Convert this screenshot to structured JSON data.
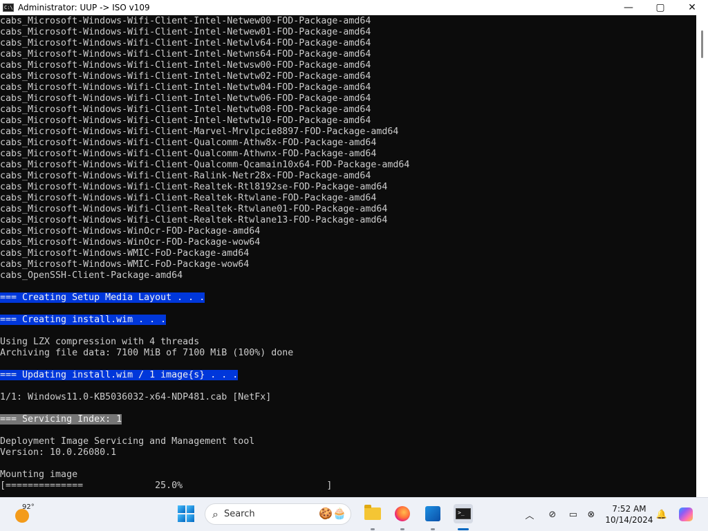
{
  "window": {
    "title": "Administrator:  UUP -> ISO v109",
    "controls": {
      "minimize": "—",
      "maximize": "▢",
      "close": "✕"
    }
  },
  "console": {
    "lines": [
      {
        "text": "cabs_Microsoft-Windows-Wifi-Client-Intel-Netwew00-FOD-Package-amd64",
        "style": ""
      },
      {
        "text": "cabs_Microsoft-Windows-Wifi-Client-Intel-Netwew01-FOD-Package-amd64",
        "style": ""
      },
      {
        "text": "cabs_Microsoft-Windows-Wifi-Client-Intel-Netwlv64-FOD-Package-amd64",
        "style": ""
      },
      {
        "text": "cabs_Microsoft-Windows-Wifi-Client-Intel-Netwns64-FOD-Package-amd64",
        "style": ""
      },
      {
        "text": "cabs_Microsoft-Windows-Wifi-Client-Intel-Netwsw00-FOD-Package-amd64",
        "style": ""
      },
      {
        "text": "cabs_Microsoft-Windows-Wifi-Client-Intel-Netwtw02-FOD-Package-amd64",
        "style": ""
      },
      {
        "text": "cabs_Microsoft-Windows-Wifi-Client-Intel-Netwtw04-FOD-Package-amd64",
        "style": ""
      },
      {
        "text": "cabs_Microsoft-Windows-Wifi-Client-Intel-Netwtw06-FOD-Package-amd64",
        "style": ""
      },
      {
        "text": "cabs_Microsoft-Windows-Wifi-Client-Intel-Netwtw08-FOD-Package-amd64",
        "style": ""
      },
      {
        "text": "cabs_Microsoft-Windows-Wifi-Client-Intel-Netwtw10-FOD-Package-amd64",
        "style": ""
      },
      {
        "text": "cabs_Microsoft-Windows-Wifi-Client-Marvel-Mrvlpcie8897-FOD-Package-amd64",
        "style": ""
      },
      {
        "text": "cabs_Microsoft-Windows-Wifi-Client-Qualcomm-Athw8x-FOD-Package-amd64",
        "style": ""
      },
      {
        "text": "cabs_Microsoft-Windows-Wifi-Client-Qualcomm-Athwnx-FOD-Package-amd64",
        "style": ""
      },
      {
        "text": "cabs_Microsoft-Windows-Wifi-Client-Qualcomm-Qcamain10x64-FOD-Package-amd64",
        "style": ""
      },
      {
        "text": "cabs_Microsoft-Windows-Wifi-Client-Ralink-Netr28x-FOD-Package-amd64",
        "style": ""
      },
      {
        "text": "cabs_Microsoft-Windows-Wifi-Client-Realtek-Rtl8192se-FOD-Package-amd64",
        "style": ""
      },
      {
        "text": "cabs_Microsoft-Windows-Wifi-Client-Realtek-Rtwlane-FOD-Package-amd64",
        "style": ""
      },
      {
        "text": "cabs_Microsoft-Windows-Wifi-Client-Realtek-Rtwlane01-FOD-Package-amd64",
        "style": ""
      },
      {
        "text": "cabs_Microsoft-Windows-Wifi-Client-Realtek-Rtwlane13-FOD-Package-amd64",
        "style": ""
      },
      {
        "text": "cabs_Microsoft-Windows-WinOcr-FOD-Package-amd64",
        "style": ""
      },
      {
        "text": "cabs_Microsoft-Windows-WinOcr-FOD-Package-wow64",
        "style": ""
      },
      {
        "text": "cabs_Microsoft-Windows-WMIC-FoD-Package-amd64",
        "style": ""
      },
      {
        "text": "cabs_Microsoft-Windows-WMIC-FoD-Package-wow64",
        "style": ""
      },
      {
        "text": "cabs_OpenSSH-Client-Package-amd64",
        "style": ""
      },
      {
        "text": "",
        "style": ""
      },
      {
        "text": "=== Creating Setup Media Layout . . .",
        "style": "blue"
      },
      {
        "text": "",
        "style": ""
      },
      {
        "text": "=== Creating install.wim . . .",
        "style": "blue"
      },
      {
        "text": "",
        "style": ""
      },
      {
        "text": "Using LZX compression with 4 threads",
        "style": ""
      },
      {
        "text": "Archiving file data: 7100 MiB of 7100 MiB (100%) done",
        "style": ""
      },
      {
        "text": "",
        "style": ""
      },
      {
        "text": "=== Updating install.wim / 1 image{s} . . .",
        "style": "blue"
      },
      {
        "text": "",
        "style": ""
      },
      {
        "text": "1/1: Windows11.0-KB5036032-x64-NDP481.cab [NetFx]",
        "style": ""
      },
      {
        "text": "",
        "style": ""
      },
      {
        "text": "=== Servicing Index: 1",
        "style": "gray"
      },
      {
        "text": "",
        "style": ""
      },
      {
        "text": "Deployment Image Servicing and Management tool",
        "style": ""
      },
      {
        "text": "Version: 10.0.26080.1",
        "style": ""
      },
      {
        "text": "",
        "style": ""
      },
      {
        "text": "Mounting image",
        "style": ""
      },
      {
        "text": "[==============             25.0%                          ]",
        "style": ""
      }
    ]
  },
  "taskbar": {
    "weather_temp": "92°",
    "search_label": "Search",
    "search_deco": "🍪🧁",
    "clock_time": "7:52 AM",
    "clock_date": "10/14/2024",
    "tray": {
      "chevron": "︿",
      "network": "⊘",
      "display": "▭",
      "volume": "⊗",
      "bell": "🔔"
    }
  },
  "colors": {
    "console_bg": "#0c0c0c",
    "console_text": "#cccccc",
    "highlight_blue": "#0037da",
    "highlight_gray": "#767676"
  }
}
